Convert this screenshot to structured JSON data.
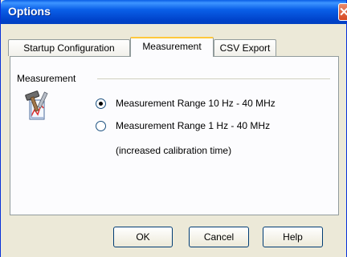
{
  "window": {
    "title": "Options",
    "close_glyph": "✕"
  },
  "tabs": [
    {
      "label": "Startup Configuration",
      "active": false
    },
    {
      "label": "Measurement",
      "active": true
    },
    {
      "label": "CSV Export",
      "active": false
    }
  ],
  "group": {
    "label": "Measurement",
    "icon": "tools-chart-icon",
    "options": [
      {
        "label": "Measurement Range 10 Hz - 40 MHz",
        "selected": true
      },
      {
        "label": "Measurement Range 1 Hz - 40 MHz",
        "selected": false
      }
    ],
    "note": "(increased calibration time)"
  },
  "buttons": {
    "ok": "OK",
    "cancel": "Cancel",
    "help": "Help"
  },
  "colors": {
    "title_bar": "#0a5fe8",
    "active_tab_highlight": "#ffc83c",
    "close_button": "#d64720"
  }
}
